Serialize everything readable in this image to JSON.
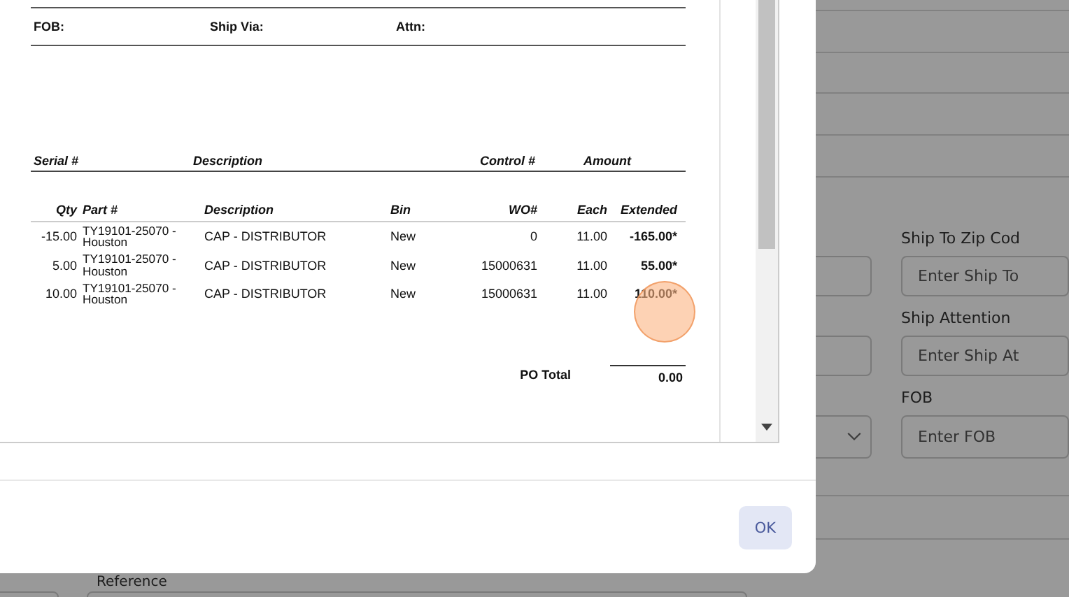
{
  "document": {
    "header_labels": [
      "FOB:",
      "Ship Via:",
      "Attn:"
    ],
    "serial_columns": [
      "Serial #",
      "Description",
      "Control #",
      "Amount"
    ],
    "item_columns": [
      "Qty",
      "Part #",
      "Description",
      "Bin",
      "WO#",
      "Each",
      "Extended"
    ],
    "items": [
      {
        "qty": "-15.00",
        "part": "TY19101-25070 - Houston",
        "description": "CAP - DISTRIBUTOR",
        "bin": "New",
        "wo": "0",
        "each": "11.00",
        "extended": "-165.00*"
      },
      {
        "qty": "5.00",
        "part": "TY19101-25070 - Houston",
        "description": "CAP - DISTRIBUTOR",
        "bin": "New",
        "wo": "15000631",
        "each": "11.00",
        "extended": "55.00*"
      },
      {
        "qty": "10.00",
        "part": "TY19101-25070 - Houston",
        "description": "CAP - DISTRIBUTOR",
        "bin": "New",
        "wo": "15000631",
        "each": "11.00",
        "extended": "110.00*"
      }
    ],
    "po_total": {
      "label": "PO Total",
      "value": "0.00"
    }
  },
  "ok_button": "OK",
  "background_form": {
    "left_fields": [
      {
        "kind": "input"
      },
      {
        "kind": "input"
      },
      {
        "kind": "select"
      }
    ],
    "right_fields": [
      {
        "label": "Ship To Zip Cod",
        "placeholder": "Enter Ship To"
      },
      {
        "label": "Ship Attention",
        "placeholder": "Enter Ship At"
      },
      {
        "label": "FOB",
        "placeholder": "Enter FOB"
      }
    ],
    "reference_label": "Reference"
  }
}
